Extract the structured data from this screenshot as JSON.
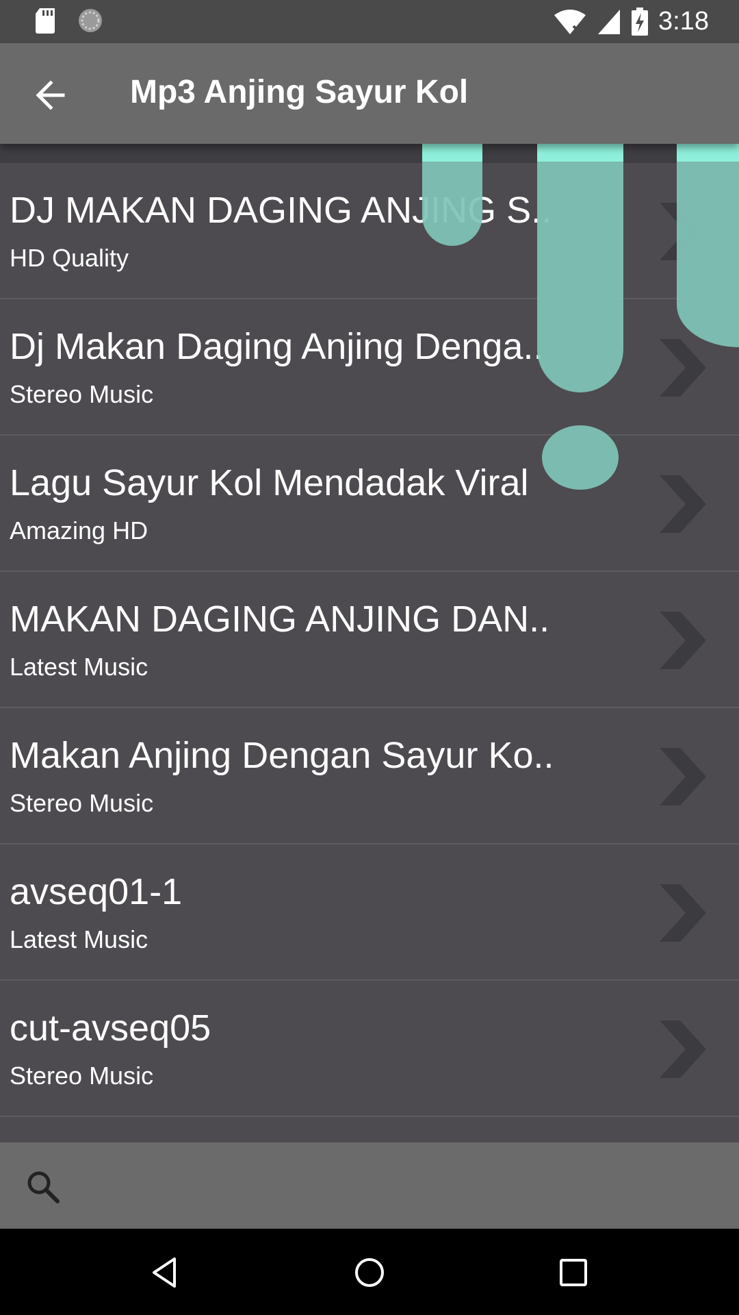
{
  "status": {
    "time": "3:18"
  },
  "header": {
    "title": "Mp3 Anjing Sayur Kol"
  },
  "list": [
    {
      "title": "DJ MAKAN DAGING ANJING S..",
      "subtitle": "HD Quality"
    },
    {
      "title": "Dj Makan Daging Anjing Denga..",
      "subtitle": "Stereo Music"
    },
    {
      "title": "Lagu Sayur Kol Mendadak Viral",
      "subtitle": "Amazing HD"
    },
    {
      "title": "MAKAN DAGING ANJING DAN..",
      "subtitle": "Latest Music"
    },
    {
      "title": "Makan Anjing Dengan Sayur Ko..",
      "subtitle": "Stereo Music"
    },
    {
      "title": "avseq01-1",
      "subtitle": "Latest Music"
    },
    {
      "title": "cut-avseq05",
      "subtitle": "Stereo Music"
    }
  ],
  "search": {
    "value": ""
  },
  "colors": {
    "accent": "#7fcfbf",
    "list_background": "#4d4b50",
    "toolbar": "#6a6a6a"
  },
  "icons": [
    "sd-card-icon",
    "sync-icon",
    "wifi-icon",
    "signal-icon",
    "battery-charging-icon",
    "back-arrow-icon",
    "chevron-right-icon",
    "search-icon",
    "nav-back-icon",
    "nav-home-icon",
    "nav-recents-icon"
  ]
}
